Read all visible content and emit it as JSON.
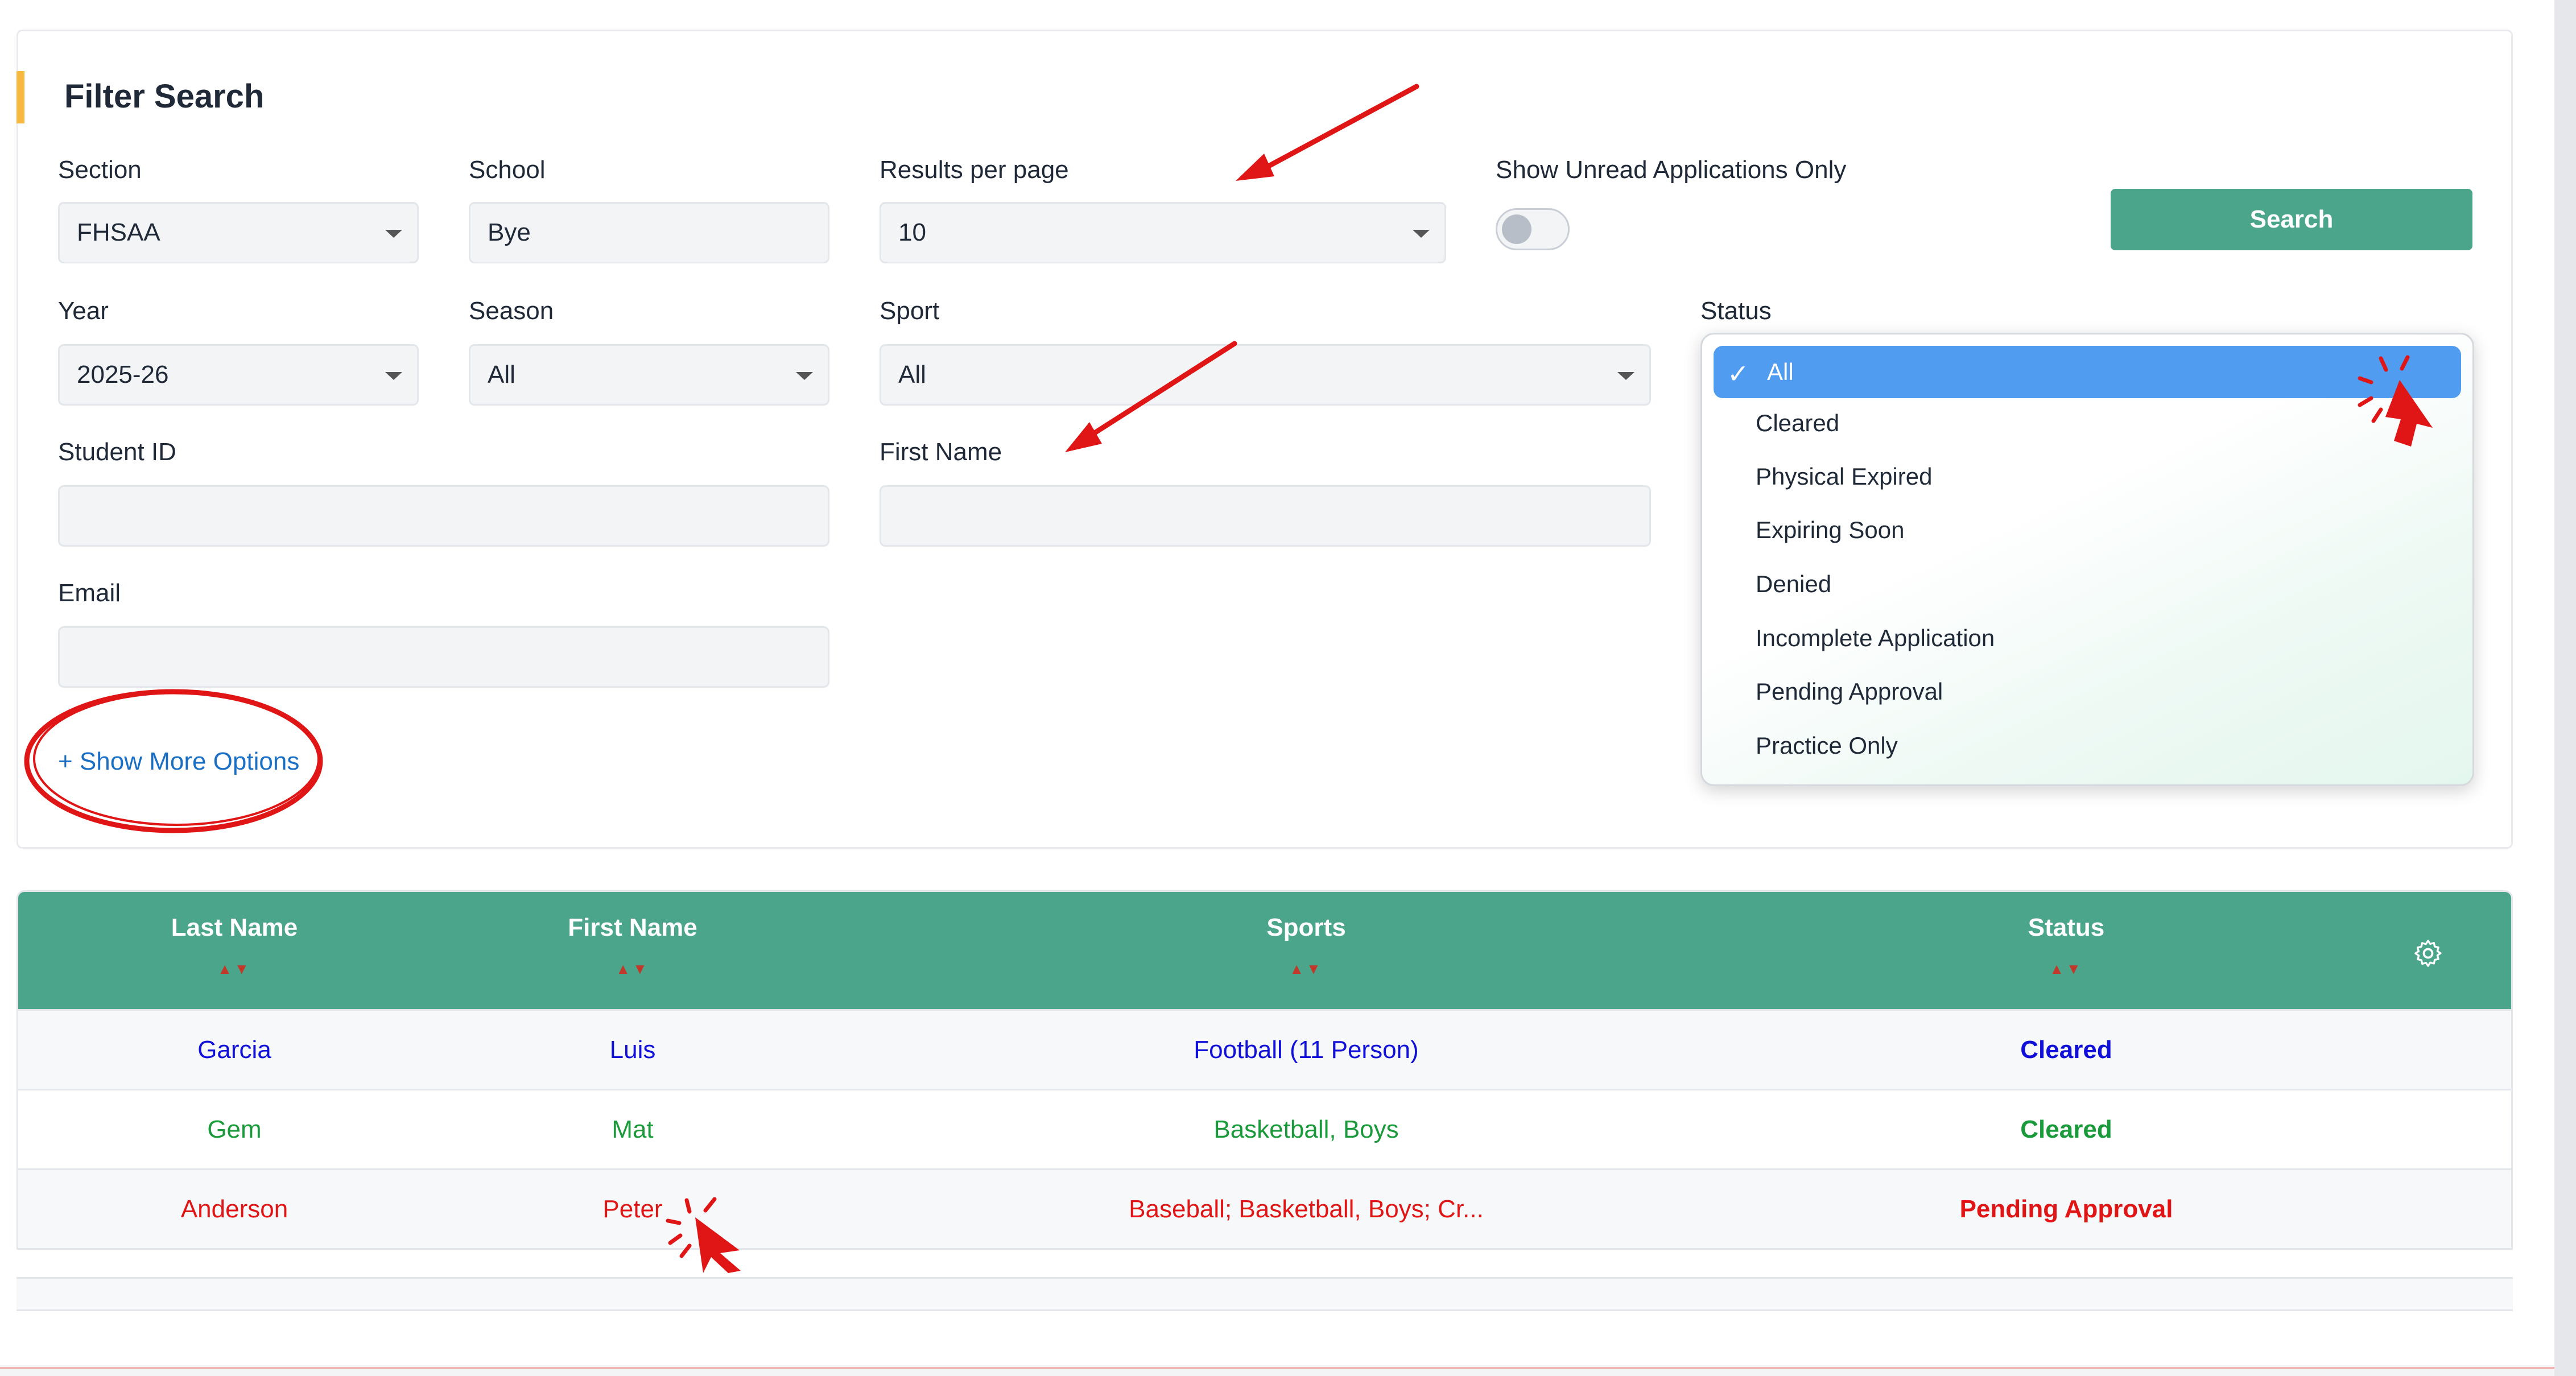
{
  "filter": {
    "title": "Filter Search",
    "section": {
      "label": "Section",
      "value": "FHSAA"
    },
    "school": {
      "label": "School",
      "value": "Bye"
    },
    "results_per_page": {
      "label": "Results per page",
      "value": "10"
    },
    "show_unread": {
      "label": "Show Unread Applications Only",
      "on": false
    },
    "search_button": "Search",
    "year": {
      "label": "Year",
      "value": "2025-26"
    },
    "season": {
      "label": "Season",
      "value": "All"
    },
    "sport": {
      "label": "Sport",
      "value": "All"
    },
    "status": {
      "label": "Status",
      "value": "All"
    },
    "student_id": {
      "label": "Student ID",
      "value": ""
    },
    "first_name": {
      "label": "First Name",
      "value": ""
    },
    "email": {
      "label": "Email",
      "value": ""
    },
    "more_options": "+ Show More Options"
  },
  "status_dropdown": {
    "options": [
      "All",
      "Cleared",
      "Physical Expired",
      "Expiring Soon",
      "Denied",
      "Incomplete Application",
      "Pending Approval",
      "Practice Only"
    ],
    "selected": "All",
    "check_glyph": "✓"
  },
  "table": {
    "columns": [
      "Last Name",
      "First Name",
      "Sports",
      "Status"
    ],
    "sort_glyph": "▲▼",
    "rows": [
      {
        "last": "Garcia",
        "first": "Luis",
        "sports": "Football (11 Person)",
        "status": "Cleared",
        "color": "#1010d8"
      },
      {
        "last": "Gem",
        "first": "Mat",
        "sports": "Basketball, Boys",
        "status": "Cleared",
        "color": "#1a9a3a"
      },
      {
        "last": "Anderson",
        "first": "Peter",
        "sports": "Baseball; Basketball, Boys; Cr...",
        "status": "Pending Approval",
        "color": "#e01515"
      }
    ]
  },
  "colors": {
    "header_green": "#4aa58a",
    "accent_yellow": "#f5b942",
    "link_blue": "#1a6fc4",
    "dropdown_selected": "#4f9cf0",
    "annotation_red": "#e01515"
  },
  "icons": [
    "gear-icon",
    "chevron-down-icon",
    "check-icon",
    "sort-icon",
    "cursor-icon"
  ]
}
